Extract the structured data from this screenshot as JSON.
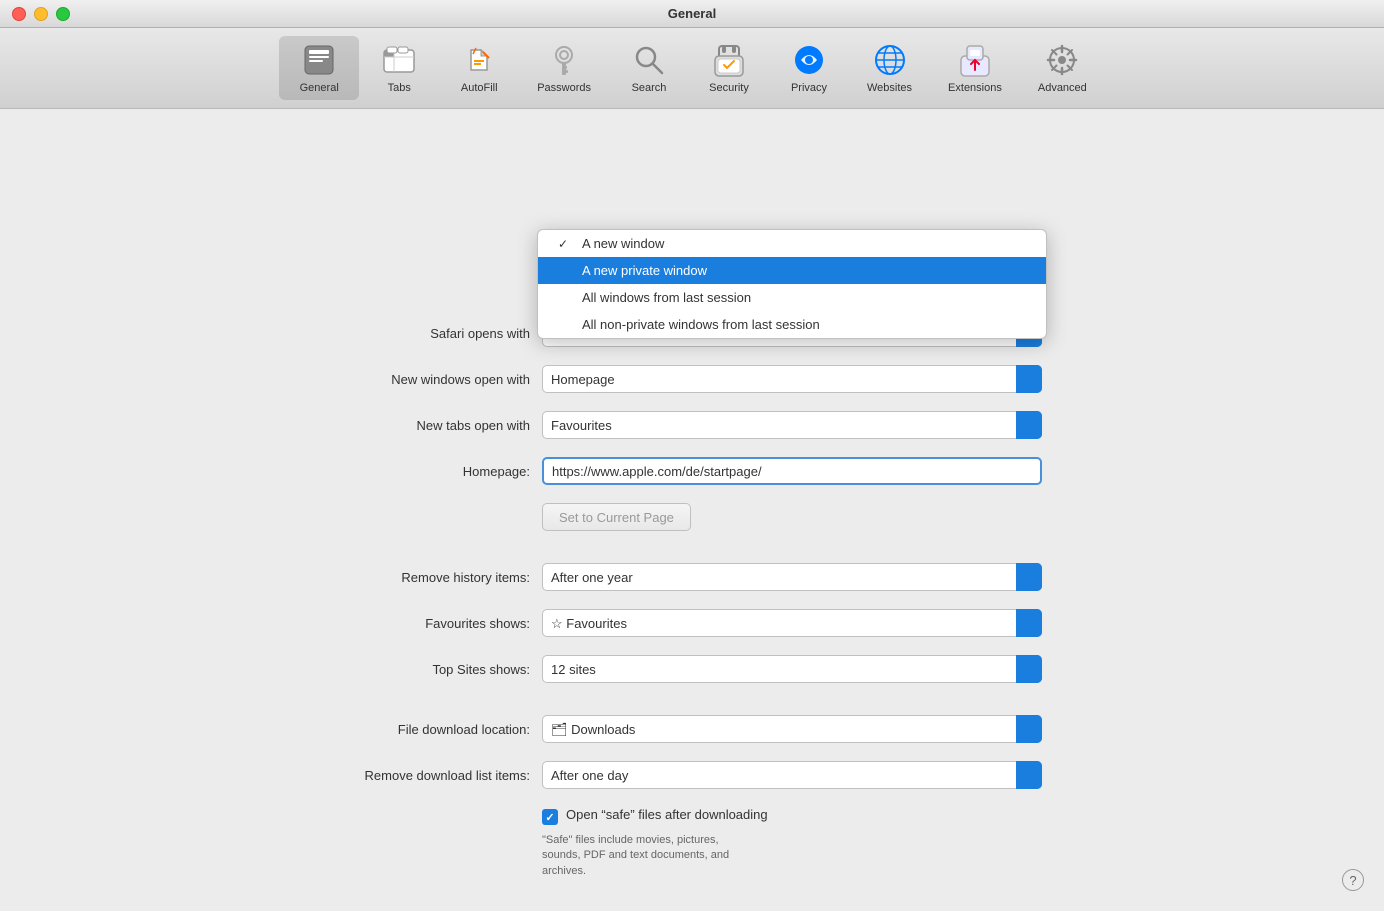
{
  "window": {
    "title": "General"
  },
  "toolbar": {
    "items": [
      {
        "id": "general",
        "label": "General",
        "active": true
      },
      {
        "id": "tabs",
        "label": "Tabs",
        "active": false
      },
      {
        "id": "autofill",
        "label": "AutoFill",
        "active": false
      },
      {
        "id": "passwords",
        "label": "Passwords",
        "active": false
      },
      {
        "id": "search",
        "label": "Search",
        "active": false
      },
      {
        "id": "security",
        "label": "Security",
        "active": false
      },
      {
        "id": "privacy",
        "label": "Privacy",
        "active": false
      },
      {
        "id": "websites",
        "label": "Websites",
        "active": false
      },
      {
        "id": "extensions",
        "label": "Extensions",
        "active": false
      },
      {
        "id": "advanced",
        "label": "Advanced",
        "active": false
      }
    ]
  },
  "form": {
    "safari_opens_with_label": "Safari opens with",
    "safari_opens_with_value": "A new window",
    "new_windows_label": "New windows open with",
    "new_windows_value": "Homepage",
    "new_tabs_label": "New tabs open with",
    "new_tabs_value": "Favourites",
    "homepage_label": "Homepage:",
    "homepage_value": "https://www.apple.com/de/startpage/",
    "set_current_page_label": "Set to Current Page",
    "remove_history_label": "Remove history items:",
    "remove_history_value": "After one year",
    "favourites_shows_label": "Favourites shows:",
    "favourites_shows_value": "Favourites",
    "top_sites_label": "Top Sites shows:",
    "top_sites_value": "12 sites",
    "file_download_label": "File download location:",
    "file_download_value": "Downloads",
    "remove_download_label": "Remove download list items:",
    "remove_download_value": "After one day",
    "open_safe_files_label": "Open “safe” files after downloading",
    "open_safe_files_sublabel": "“Safe” files include movies, pictures,\nsounds, PDF and text documents, and\narchives."
  },
  "dropdown": {
    "items": [
      {
        "label": "A new window",
        "checked": true,
        "selected": false
      },
      {
        "label": "A new private window",
        "checked": false,
        "selected": true
      },
      {
        "label": "All windows from last session",
        "checked": false,
        "selected": false
      },
      {
        "label": "All non-private windows from last session",
        "checked": false,
        "selected": false
      }
    ]
  },
  "colors": {
    "accent": "#1a7edf",
    "selected_bg": "#1a7edf",
    "toolbar_bg": "#d8d8d8",
    "main_bg": "#ececec"
  }
}
